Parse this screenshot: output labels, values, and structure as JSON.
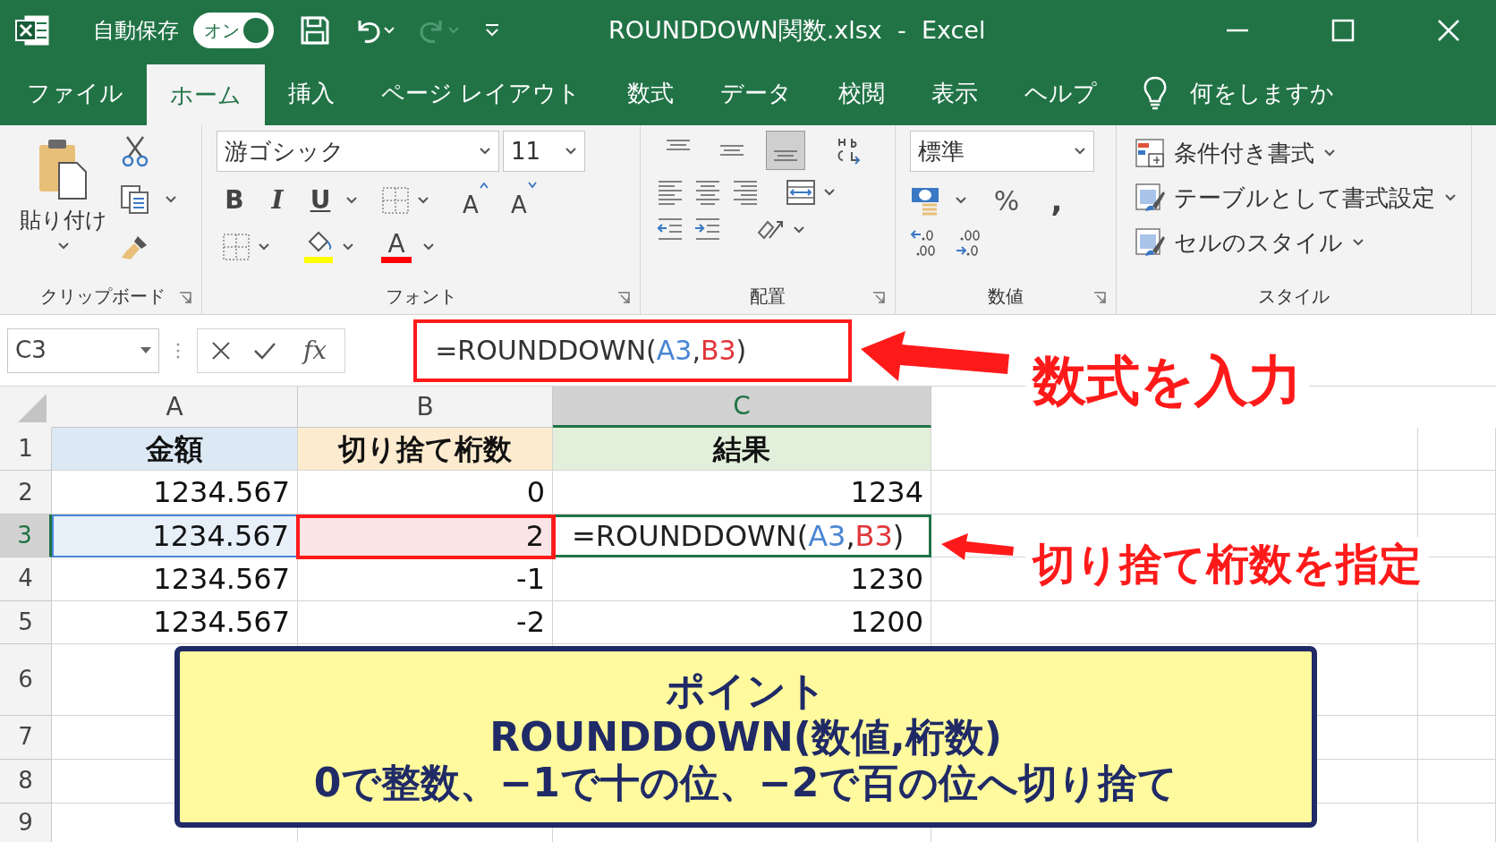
{
  "window": {
    "title": "ROUNDDOWN関数.xlsx  -  Excel",
    "autosave_label": "自動保存",
    "autosave": {
      "label": "オン",
      "on": true
    }
  },
  "tabs": [
    {
      "label": "ファイル",
      "selected": false
    },
    {
      "label": "ホーム",
      "selected": true
    },
    {
      "label": "挿入",
      "selected": false
    },
    {
      "label": "ページ レイアウト",
      "selected": false
    },
    {
      "label": "数式",
      "selected": false
    },
    {
      "label": "データ",
      "selected": false
    },
    {
      "label": "校閲",
      "selected": false
    },
    {
      "label": "表示",
      "selected": false
    },
    {
      "label": "ヘルプ",
      "selected": false
    }
  ],
  "tell_me": "何をしますか",
  "ribbon": {
    "clipboard": {
      "paste": "貼り付け",
      "group": "クリップボード"
    },
    "font": {
      "name": "游ゴシック",
      "size": "11",
      "bold": "B",
      "italic": "I",
      "underline": "U",
      "grow": "A",
      "shrink": "A",
      "font_color": "A",
      "group": "フォント"
    },
    "alignment": {
      "vertical": [
        {
          "selected": false
        },
        {
          "selected": false
        },
        {
          "selected": true
        }
      ],
      "group": "配置"
    },
    "number": {
      "format": "標準",
      "percent": "%",
      "comma": ",",
      "group": "数値"
    },
    "styles": {
      "items": [
        "条件付き書式",
        "テーブルとして書式設定",
        "セルのスタイル"
      ],
      "group": "スタイル"
    }
  },
  "formula_bar": {
    "name_box": "C3",
    "fx": "fx",
    "formula": [
      {
        "text": "=ROUNDDOWN(",
        "color": "#333333"
      },
      {
        "text": "A3",
        "color": "#4a86d4"
      },
      {
        "text": ",",
        "color": "#333333"
      },
      {
        "text": "B3",
        "color": "#e0363a"
      },
      {
        "text": ")",
        "color": "#333333"
      }
    ]
  },
  "sheet": {
    "columns": [
      {
        "label": "A",
        "selected": false
      },
      {
        "label": "B",
        "selected": false
      },
      {
        "label": "C",
        "selected": true
      }
    ],
    "rows": [
      {
        "label": "1",
        "selected": false,
        "cells": [
          {
            "kind": "header",
            "text": "金額",
            "color": "#dde8f5"
          },
          {
            "kind": "header",
            "text": "切り捨て桁数",
            "color": "#fdebcf"
          },
          {
            "kind": "header",
            "text": "結果",
            "color": "#e2efda"
          }
        ]
      },
      {
        "label": "2",
        "selected": false,
        "cells": [
          {
            "kind": "value",
            "text": "1234.567"
          },
          {
            "kind": "value",
            "text": "0"
          },
          {
            "kind": "value",
            "text": "1234"
          }
        ]
      },
      {
        "label": "3",
        "selected": true,
        "cells": [
          {
            "kind": "ref",
            "text": "1234.567",
            "color": "#4a86d4"
          },
          {
            "kind": "ref",
            "text": "2",
            "color": "#e0363a"
          },
          {
            "kind": "editing",
            "parts": [
              {
                "text": "=ROUNDDOWN(",
                "color": "#222222"
              },
              {
                "text": "A3",
                "color": "#4a86d4"
              },
              {
                "text": ",",
                "color": "#222222"
              },
              {
                "text": "B3",
                "color": "#e0363a"
              },
              {
                "text": ")",
                "color": "#222222"
              }
            ]
          }
        ]
      },
      {
        "label": "4",
        "selected": false,
        "cells": [
          {
            "kind": "value",
            "text": "1234.567"
          },
          {
            "kind": "value",
            "text": "-1"
          },
          {
            "kind": "value",
            "text": "1230"
          }
        ]
      },
      {
        "label": "5",
        "selected": false,
        "cells": [
          {
            "kind": "value",
            "text": "1234.567"
          },
          {
            "kind": "value",
            "text": "-2"
          },
          {
            "kind": "value",
            "text": "1200"
          }
        ]
      },
      {
        "label": "6",
        "selected": false,
        "cells": []
      },
      {
        "label": "7",
        "selected": false,
        "cells": []
      },
      {
        "label": "8",
        "selected": false,
        "cells": []
      },
      {
        "label": "9",
        "selected": false,
        "cells": []
      }
    ]
  },
  "annotations": [
    {
      "text": "数式を入力"
    },
    {
      "text": "切り捨て桁数を指定"
    }
  ],
  "callout": {
    "lines": [
      "ポイント",
      "ROUNDDOWN(数値,桁数)",
      "0で整数、−1で十の位、−2で百の位へ切り捨て"
    ]
  }
}
